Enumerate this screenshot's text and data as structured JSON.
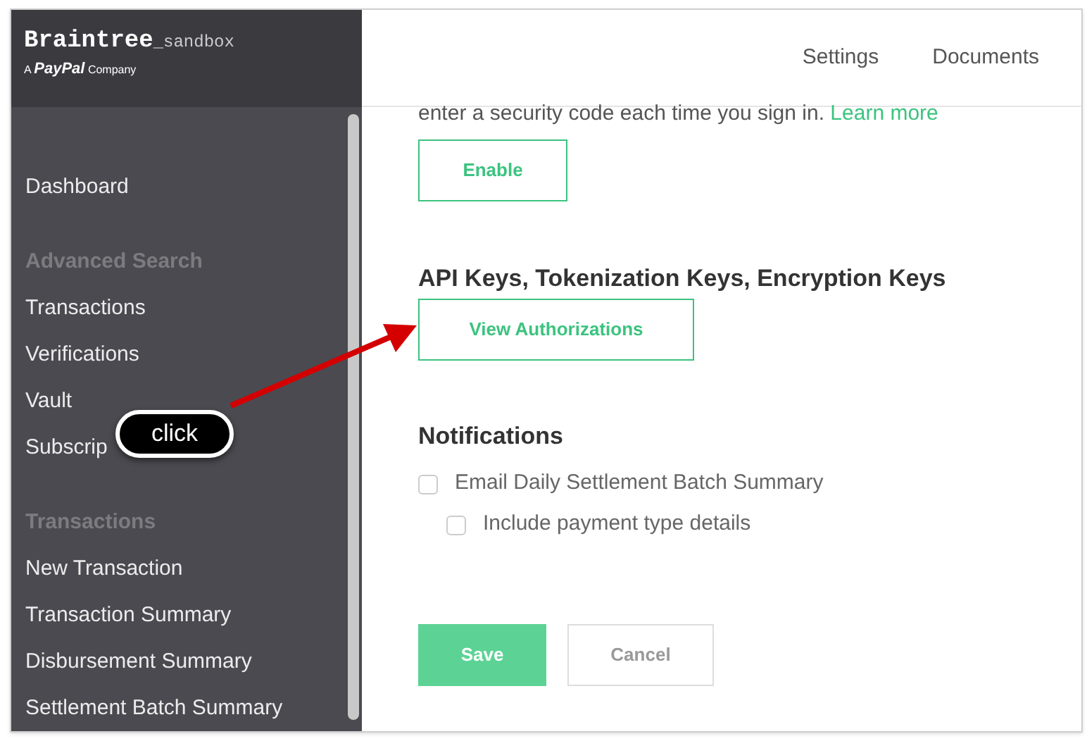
{
  "logo": {
    "name": "Braintree",
    "suffix": "_sandbox",
    "tagline": "A **PayPal** Company"
  },
  "top_nav": [
    "Settings",
    "Documents"
  ],
  "sidebar": {
    "items": [
      {
        "kind": "link",
        "label": "Dashboard"
      },
      {
        "kind": "heading",
        "label": "Advanced Search"
      },
      {
        "kind": "link",
        "label": "Transactions"
      },
      {
        "kind": "link",
        "label": "Verifications"
      },
      {
        "kind": "link",
        "label": "Vault"
      },
      {
        "kind": "link",
        "label": "Subscrip"
      },
      {
        "kind": "heading",
        "label": "Transactions"
      },
      {
        "kind": "link",
        "label": "New Transaction"
      },
      {
        "kind": "link",
        "label": "Transaction Summary"
      },
      {
        "kind": "link",
        "label": "Disbursement Summary"
      },
      {
        "kind": "link",
        "label": "Settlement Batch Summary"
      }
    ]
  },
  "two_factor": {
    "text": "enter a security code each time you sign in.",
    "link": "Learn more",
    "button": "Enable"
  },
  "api_keys": {
    "heading": "API Keys, Tokenization Keys, Encryption Keys",
    "button": "View Authorizations"
  },
  "notifications": {
    "heading": "Notifications",
    "options": [
      {
        "label": "Email Daily Settlement Batch Summary",
        "checked": false,
        "children": [
          {
            "label": "Include payment type details",
            "checked": false
          }
        ]
      }
    ]
  },
  "actions": {
    "save": "Save",
    "cancel": "Cancel"
  },
  "annotation": {
    "label": "click"
  }
}
